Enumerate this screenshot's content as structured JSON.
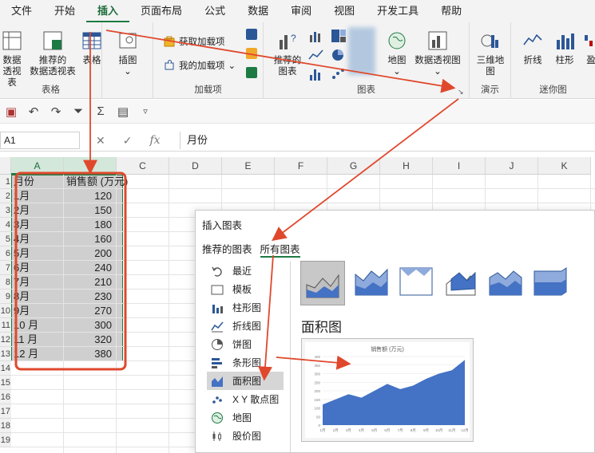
{
  "ribbon_tabs": [
    {
      "label": "文件",
      "active": false
    },
    {
      "label": "开始",
      "active": false
    },
    {
      "label": "插入",
      "active": true
    },
    {
      "label": "页面布局",
      "active": false
    },
    {
      "label": "公式",
      "active": false
    },
    {
      "label": "数据",
      "active": false
    },
    {
      "label": "审阅",
      "active": false
    },
    {
      "label": "视图",
      "active": false
    },
    {
      "label": "开发工具",
      "active": false
    },
    {
      "label": "帮助",
      "active": false
    }
  ],
  "ribbon": {
    "tables_group": {
      "label": "表格",
      "pivot_table_line1": "数据",
      "pivot_table_line2": "透视表",
      "recommended_pivot_line1": "推荐的",
      "recommended_pivot_line2": "数据透视表",
      "table": "表格"
    },
    "illustrations": {
      "label": "插图"
    },
    "addins_group": {
      "label": "加载项",
      "get_addins": "获取加载项",
      "my_addins": "我的加载项"
    },
    "charts_group": {
      "label": "图表",
      "recommended_charts_line1": "推荐的",
      "recommended_charts_line2": "图表",
      "map": "地图",
      "pivot_chart": "数据透视图"
    },
    "tours_group": {
      "label": "演示",
      "map3d_line1": "三维地",
      "map3d_line2": "图"
    },
    "sparklines_group": {
      "label": "迷你图",
      "line": "折线",
      "column": "柱形",
      "winloss": "盈"
    }
  },
  "formula_bar": {
    "name_box": "A1",
    "content": "月份"
  },
  "columns": [
    "A",
    "B",
    "C",
    "D",
    "E",
    "F",
    "G",
    "H",
    "I",
    "J",
    "K"
  ],
  "row_numbers": [
    "1",
    "2",
    "3",
    "4",
    "5",
    "6",
    "7",
    "8",
    "9",
    "10",
    "11",
    "12",
    "13",
    "14",
    "15",
    "16",
    "17",
    "18",
    "19"
  ],
  "sheet": {
    "header_month": "月份",
    "header_sales": "销售额 (万元)",
    "rows": [
      {
        "month": "1月",
        "sales": "120"
      },
      {
        "month": "2月",
        "sales": "150"
      },
      {
        "month": "3月",
        "sales": "180"
      },
      {
        "month": "4月",
        "sales": "160"
      },
      {
        "month": "5月",
        "sales": "200"
      },
      {
        "month": "6月",
        "sales": "240"
      },
      {
        "month": "7月",
        "sales": "210"
      },
      {
        "month": "8月",
        "sales": "230"
      },
      {
        "month": "9月",
        "sales": "270"
      },
      {
        "month": "10 月",
        "sales": "300"
      },
      {
        "month": "11 月",
        "sales": "320"
      },
      {
        "month": "12 月",
        "sales": "380"
      }
    ]
  },
  "dialog": {
    "title": "插入图表",
    "tab_recommended": "推荐的图表",
    "tab_all": "所有图表",
    "categories": [
      {
        "label": "最近",
        "icon": "undo-icon"
      },
      {
        "label": "模板",
        "icon": "folder-icon"
      },
      {
        "label": "柱形图",
        "icon": "column-chart-icon"
      },
      {
        "label": "折线图",
        "icon": "line-chart-icon"
      },
      {
        "label": "饼图",
        "icon": "pie-chart-icon"
      },
      {
        "label": "条形图",
        "icon": "bar-chart-icon"
      },
      {
        "label": "面积图",
        "icon": "area-chart-icon",
        "selected": true
      },
      {
        "label": "X Y 散点图",
        "icon": "scatter-chart-icon"
      },
      {
        "label": "地图",
        "icon": "globe-icon"
      },
      {
        "label": "股价图",
        "icon": "stock-chart-icon"
      }
    ],
    "selected_type_title": "面积图",
    "preview_title": "销售额 (万元)"
  },
  "colors": {
    "excel_green": "#1e7a43",
    "annotation_red": "#e0482c",
    "chart_blue": "#4472c4"
  },
  "chart_data": {
    "type": "area",
    "title": "销售额 (万元)",
    "categories": [
      "1月",
      "2月",
      "3月",
      "4月",
      "5月",
      "6月",
      "7月",
      "8月",
      "9月",
      "10月",
      "11月",
      "12月"
    ],
    "values": [
      120,
      150,
      180,
      160,
      200,
      240,
      210,
      230,
      270,
      300,
      320,
      380
    ],
    "ylim": [
      0,
      400
    ],
    "yticks": [
      0,
      50,
      100,
      150,
      200,
      250,
      300,
      350,
      400
    ],
    "grid": true
  }
}
